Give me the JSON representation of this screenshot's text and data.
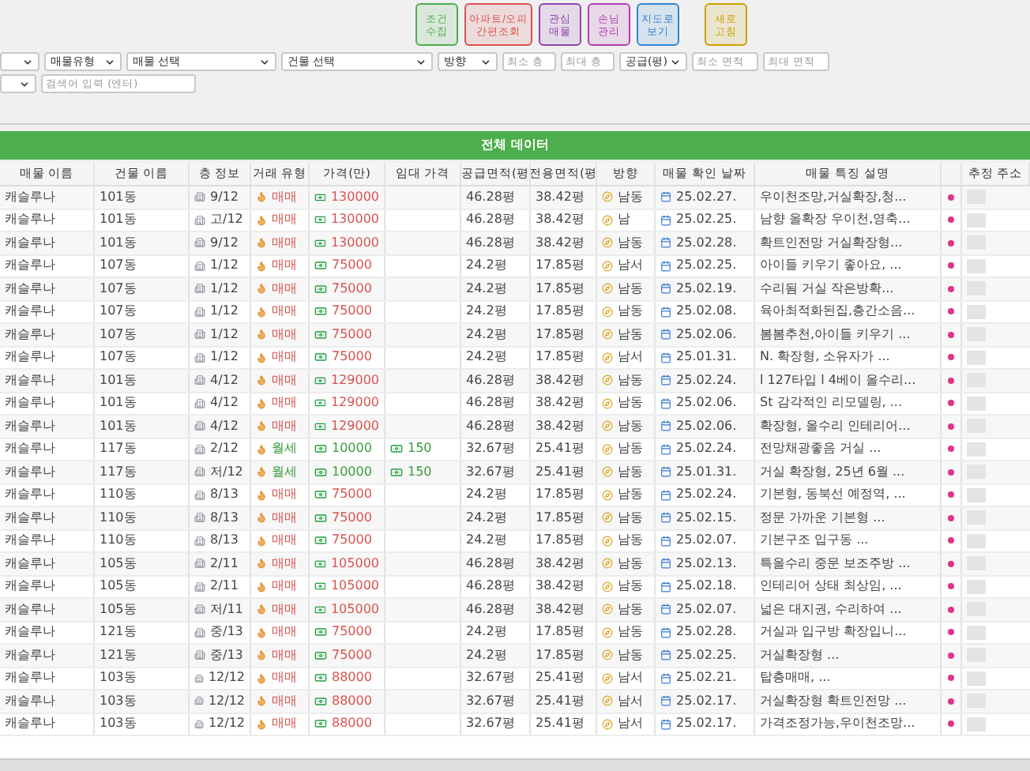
{
  "toolbar_buttons": [
    {
      "lines": [
        "조건",
        "수집"
      ],
      "color": "#4cae4c"
    },
    {
      "lines": [
        "아파트/오피",
        "간편조회"
      ],
      "color": "#d9534f"
    },
    {
      "lines": [
        "관심",
        "매물"
      ],
      "color": "#8e44ad"
    },
    {
      "lines": [
        "손님",
        "관리"
      ],
      "color": "#b23cb2"
    },
    {
      "lines": [
        "지도로",
        "보기"
      ],
      "color": "#2f86d1"
    },
    {
      "lines": [
        "새로",
        "고침"
      ],
      "color": "#c9a100"
    }
  ],
  "filters": [
    {
      "kind": "select"
    },
    {
      "kind": "select",
      "label": "매물유형"
    },
    {
      "kind": "select",
      "label": "매물 선택"
    },
    {
      "kind": "select",
      "label": "건물 선택"
    },
    {
      "kind": "select",
      "label": "방향"
    },
    {
      "kind": "input",
      "placeholder": "최소 층"
    },
    {
      "kind": "input",
      "placeholder": "최대 층"
    },
    {
      "kind": "select",
      "label": "공급(평)"
    },
    {
      "kind": "input",
      "placeholder": "최소 면적"
    },
    {
      "kind": "input",
      "placeholder": "최대 면적"
    }
  ],
  "search_row": [
    {
      "kind": "select"
    },
    {
      "kind": "input",
      "placeholder": "검색어 입력 (엔터)"
    }
  ],
  "banner": "전체 데이터",
  "table": {
    "columns": [
      "매물 이름",
      "건물 이름",
      "층 정보",
      "거래 유형",
      "가격(만)",
      "임대 가격",
      "공급면적(평",
      "전용면적(평",
      "방향",
      "매물 확인 날짜",
      "매물 특징 설명",
      "추정 주소"
    ],
    "rows": [
      {
        "name": "캐슬루나",
        "building": "101동",
        "floor": "9/12",
        "kind": "sale",
        "deal": "매매",
        "price": "130000",
        "supply": "46.28평",
        "exclusive": "38.42평",
        "direction": "남동",
        "date": "25.02.27.",
        "desc": "우이천조망,거실확장,청..."
      },
      {
        "name": "캐슬루나",
        "building": "101동",
        "floor": "고/12",
        "kind": "sale",
        "deal": "매매",
        "price": "130000",
        "supply": "46.28평",
        "exclusive": "38.42평",
        "direction": "남",
        "date": "25.02.25.",
        "desc": "남향 올확장 우이천,영축..."
      },
      {
        "name": "캐슬루나",
        "building": "101동",
        "floor": "9/12",
        "kind": "sale",
        "deal": "매매",
        "price": "130000",
        "supply": "46.28평",
        "exclusive": "38.42평",
        "direction": "남동",
        "date": "25.02.28.",
        "desc": "확트인전망  거실확장형..."
      },
      {
        "name": "캐슬루나",
        "building": "107동",
        "floor": "1/12",
        "kind": "sale",
        "deal": "매매",
        "price": "75000",
        "supply": "24.2평",
        "exclusive": "17.85평",
        "direction": "남서",
        "date": "25.02.25.",
        "desc": "아이들 키우기 좋아요, ..."
      },
      {
        "name": "캐슬루나",
        "building": "107동",
        "floor": "1/12",
        "kind": "sale",
        "deal": "매매",
        "price": "75000",
        "supply": "24.2평",
        "exclusive": "17.85평",
        "direction": "남동",
        "date": "25.02.19.",
        "desc": "수리됨  거실  작은방확..."
      },
      {
        "name": "캐슬루나",
        "building": "107동",
        "floor": "1/12",
        "kind": "sale",
        "deal": "매매",
        "price": "75000",
        "supply": "24.2평",
        "exclusive": "17.85평",
        "direction": "남동",
        "date": "25.02.08.",
        "desc": "육아최적화된집,층간소음..."
      },
      {
        "name": "캐슬루나",
        "building": "107동",
        "floor": "1/12",
        "kind": "sale",
        "deal": "매매",
        "price": "75000",
        "supply": "24.2평",
        "exclusive": "17.85평",
        "direction": "남동",
        "date": "25.02.06.",
        "desc": "봄봄추천,아이들 키우기 ..."
      },
      {
        "name": "캐슬루나",
        "building": "107동",
        "floor": "1/12",
        "kind": "sale",
        "deal": "매매",
        "price": "75000",
        "supply": "24.2평",
        "exclusive": "17.85평",
        "direction": "남서",
        "date": "25.01.31.",
        "desc": "N. 확장형, 소유자가 ..."
      },
      {
        "name": "캐슬루나",
        "building": "101동",
        "floor": "4/12",
        "kind": "sale",
        "deal": "매매",
        "price": "129000",
        "supply": "46.28평",
        "exclusive": "38.42평",
        "direction": "남동",
        "date": "25.02.24.",
        "desc": "l 127타입 l 4베이 올수리..."
      },
      {
        "name": "캐슬루나",
        "building": "101동",
        "floor": "4/12",
        "kind": "sale",
        "deal": "매매",
        "price": "129000",
        "supply": "46.28평",
        "exclusive": "38.42평",
        "direction": "남동",
        "date": "25.02.06.",
        "desc": "St 감각적인 리모델링, ..."
      },
      {
        "name": "캐슬루나",
        "building": "101동",
        "floor": "4/12",
        "kind": "sale",
        "deal": "매매",
        "price": "129000",
        "supply": "46.28평",
        "exclusive": "38.42평",
        "direction": "남동",
        "date": "25.02.06.",
        "desc": "확장형, 올수리 인테리어..."
      },
      {
        "name": "캐슬루나",
        "building": "117동",
        "floor": "2/12",
        "kind": "rent",
        "deal": "월세",
        "price": "10000",
        "rent": "150",
        "supply": "32.67평",
        "exclusive": "25.41평",
        "direction": "남동",
        "date": "25.02.24.",
        "desc": "전망채광좋음  거실 ..."
      },
      {
        "name": "캐슬루나",
        "building": "117동",
        "floor": "저/12",
        "kind": "rent",
        "deal": "월세",
        "price": "10000",
        "rent": "150",
        "supply": "32.67평",
        "exclusive": "25.41평",
        "direction": "남동",
        "date": "25.01.31.",
        "desc": "거실 확장형, 25년 6월 ..."
      },
      {
        "name": "캐슬루나",
        "building": "110동",
        "floor": "8/13",
        "kind": "sale",
        "deal": "매매",
        "price": "75000",
        "supply": "24.2평",
        "exclusive": "17.85평",
        "direction": "남동",
        "date": "25.02.24.",
        "desc": "기본형, 동북선 예정역, ..."
      },
      {
        "name": "캐슬루나",
        "building": "110동",
        "floor": "8/13",
        "kind": "sale",
        "deal": "매매",
        "price": "75000",
        "supply": "24.2평",
        "exclusive": "17.85평",
        "direction": "남동",
        "date": "25.02.15.",
        "desc": "정문 가까운 기본형 ..."
      },
      {
        "name": "캐슬루나",
        "building": "110동",
        "floor": "8/13",
        "kind": "sale",
        "deal": "매매",
        "price": "75000",
        "supply": "24.2평",
        "exclusive": "17.85평",
        "direction": "남동",
        "date": "25.02.07.",
        "desc": "기본구조  입구동 ..."
      },
      {
        "name": "캐슬루나",
        "building": "105동",
        "floor": "2/11",
        "kind": "sale",
        "deal": "매매",
        "price": "105000",
        "supply": "46.28평",
        "exclusive": "38.42평",
        "direction": "남동",
        "date": "25.02.13.",
        "desc": "특올수리 중문 보조주방 ..."
      },
      {
        "name": "캐슬루나",
        "building": "105동",
        "floor": "2/11",
        "kind": "sale",
        "deal": "매매",
        "price": "105000",
        "supply": "46.28평",
        "exclusive": "38.42평",
        "direction": "남동",
        "date": "25.02.18.",
        "desc": "인테리어 상태 최상임, ..."
      },
      {
        "name": "캐슬루나",
        "building": "105동",
        "floor": "저/11",
        "kind": "sale",
        "deal": "매매",
        "price": "105000",
        "supply": "46.28평",
        "exclusive": "38.42평",
        "direction": "남동",
        "date": "25.02.07.",
        "desc": "넓은 대지권, 수리하여 ..."
      },
      {
        "name": "캐슬루나",
        "building": "121동",
        "floor": "중/13",
        "kind": "sale",
        "deal": "매매",
        "price": "75000",
        "supply": "24.2평",
        "exclusive": "17.85평",
        "direction": "남동",
        "date": "25.02.28.",
        "desc": "거실과 입구방 확장입니..."
      },
      {
        "name": "캐슬루나",
        "building": "121동",
        "floor": "중/13",
        "kind": "sale",
        "deal": "매매",
        "price": "75000",
        "supply": "24.2평",
        "exclusive": "17.85평",
        "direction": "남동",
        "date": "25.02.25.",
        "desc": "거실확장형  ..."
      },
      {
        "name": "캐슬루나",
        "building": "103동",
        "floor": "12/12",
        "kind": "sale",
        "deal": "매매",
        "price": "88000",
        "supply": "32.67평",
        "exclusive": "25.41평",
        "direction": "남서",
        "date": "25.02.21.",
        "desc": "탑층매매, ..."
      },
      {
        "name": "캐슬루나",
        "building": "103동",
        "floor": "12/12",
        "kind": "sale",
        "deal": "매매",
        "price": "88000",
        "supply": "32.67평",
        "exclusive": "25.41평",
        "direction": "남서",
        "date": "25.02.17.",
        "desc": "거실확장형  확트인전망 ..."
      },
      {
        "name": "캐슬루나",
        "building": "103동",
        "floor": "12/12",
        "kind": "sale",
        "deal": "매매",
        "price": "88000",
        "supply": "32.67평",
        "exclusive": "25.41평",
        "direction": "남서",
        "date": "25.02.17.",
        "desc": "가격조정가능,우이천조망..."
      }
    ]
  }
}
